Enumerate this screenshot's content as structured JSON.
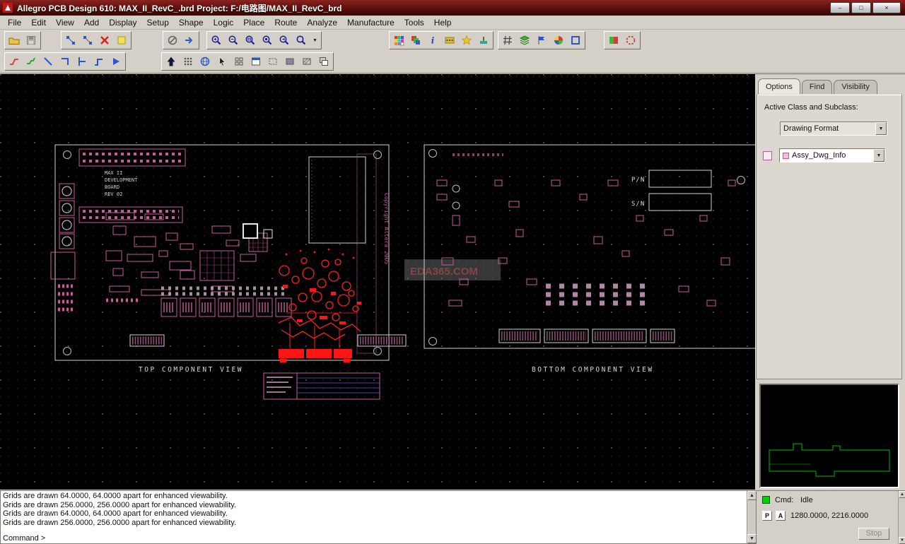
{
  "window": {
    "title": "Allegro PCB Design 610: MAX_II_RevC_.brd  Project: F:/电路图/MAX_II_RevC_brd",
    "minimize": "–",
    "maximize": "□",
    "close": "×"
  },
  "menu": {
    "items": [
      "File",
      "Edit",
      "View",
      "Add",
      "Display",
      "Setup",
      "Shape",
      "Logic",
      "Place",
      "Route",
      "Analyze",
      "Manufacture",
      "Tools",
      "Help"
    ]
  },
  "icons": {
    "combo_arrow": "▼",
    "scroll_up": "▲",
    "scroll_down": "▼"
  },
  "canvas": {
    "top_view_label": "TOP COMPONENT VIEW",
    "bottom_view_label": "BOTTOM COMPONENT VIEW",
    "pn_label": "P/N",
    "sn_label": "S/N",
    "watermark": "EDA365.COM",
    "board_name_lines": [
      "MAX II",
      "DEVELOPMENT",
      "BOARD",
      "REV 02"
    ],
    "copyright_text": "Copyright Altera 2005"
  },
  "panel": {
    "tabs": [
      "Options",
      "Find",
      "Visibility"
    ],
    "active_tab": "Options",
    "active_class_label": "Active Class and Subclass:",
    "class_value": "Drawing Format",
    "subclass_value": "Assy_Dwg_Info"
  },
  "console": {
    "lines": [
      "Grids are drawn 64.0000, 64.0000 apart for enhanced viewability.",
      "Grids are drawn 256.0000, 256.0000 apart for enhanced viewability.",
      "Grids are drawn 64.0000, 64.0000 apart for enhanced viewability.",
      "Grids are drawn 256.0000, 256.0000 apart for enhanced viewability."
    ],
    "prompt": "Command >"
  },
  "status": {
    "cmd_label": "Cmd:",
    "cmd_value": "Idle",
    "p_label": "P",
    "a_label": "A",
    "coords": "1280.0000, 2216.0000",
    "stop_label": "Stop"
  }
}
